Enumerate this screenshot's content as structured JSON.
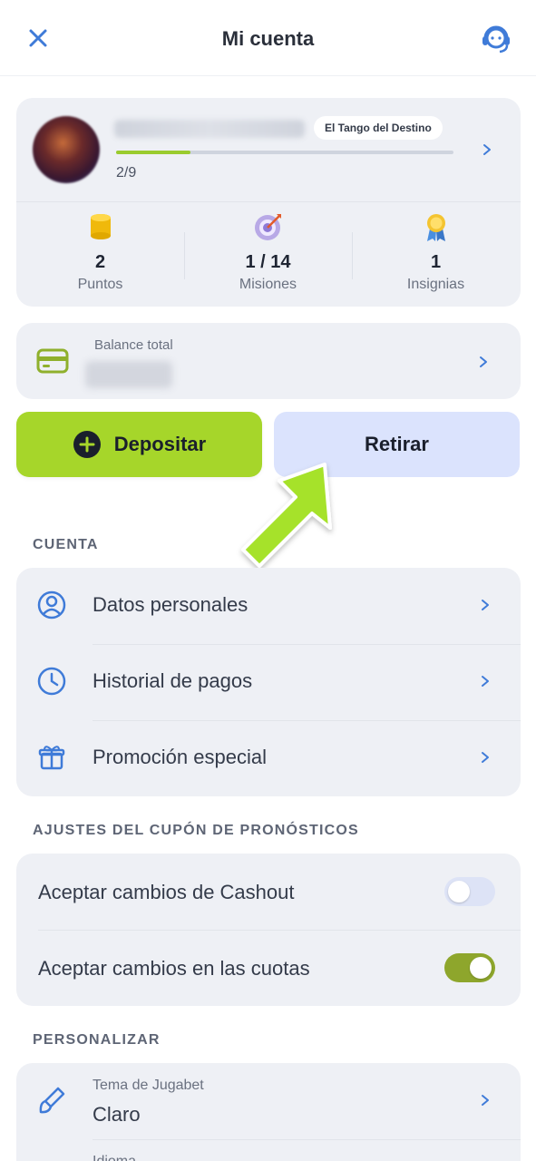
{
  "header": {
    "title": "Mi cuenta",
    "close_icon": "close-icon",
    "support_icon": "headset-support-icon"
  },
  "profile": {
    "level_name": "El Tango del Destino",
    "progress_text": "2/9",
    "progress_fraction": 0.22,
    "stats": [
      {
        "value": "2",
        "label": "Puntos",
        "icon": "coins-icon"
      },
      {
        "value": "1 / 14",
        "label": "Misiones",
        "icon": "target-icon"
      },
      {
        "value": "1",
        "label": "Insignias",
        "icon": "medal-icon"
      }
    ]
  },
  "balance": {
    "label": "Balance total"
  },
  "actions": {
    "deposit_label": "Depositar",
    "withdraw_label": "Retirar"
  },
  "sections": {
    "account_title": "CUENTA",
    "account_items": [
      {
        "label": "Datos personales",
        "icon": "user-circle-icon"
      },
      {
        "label": "Historial de pagos",
        "icon": "clock-icon"
      },
      {
        "label": "Promoción especial",
        "icon": "gift-icon"
      }
    ],
    "coupon_title": "AJUSTES DEL CUPÓN DE PRONÓSTICOS",
    "coupon_items": [
      {
        "label": "Aceptar cambios de Cashout",
        "on": false
      },
      {
        "label": "Aceptar cambios en las cuotas",
        "on": true
      }
    ],
    "personalize_title": "PERSONALIZAR",
    "theme_label": "Tema de Jugabet",
    "theme_value": "Claro",
    "language_label": "Idioma"
  },
  "colors": {
    "accent_green": "#a6d62a",
    "withdraw_bg": "#dbe3fd",
    "icon_blue": "#3f7bd8",
    "card_bg": "#eef0f5"
  }
}
